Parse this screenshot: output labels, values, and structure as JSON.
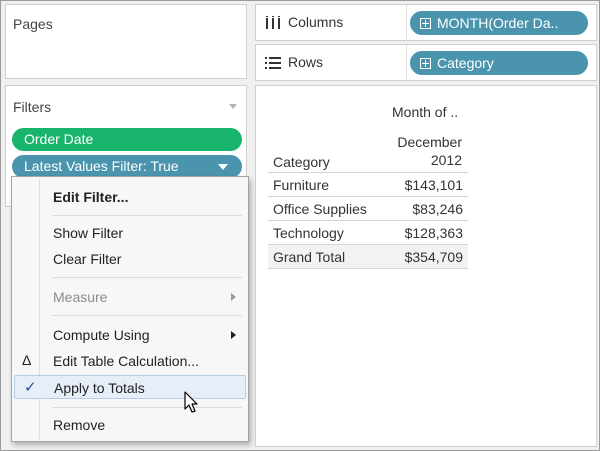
{
  "pages_panel": {
    "title": "Pages"
  },
  "filters_panel": {
    "title": "Filters",
    "pills": [
      {
        "label": "Order Date",
        "color": "#19b46b"
      },
      {
        "label": "Latest Values Filter: True",
        "color": "#4a95ad"
      }
    ]
  },
  "shelves": {
    "columns": {
      "label": "Columns",
      "pill": "MONTH(Order Da.."
    },
    "rows": {
      "label": "Rows",
      "pill": "Category"
    }
  },
  "viz": {
    "column_header": "Month of ..",
    "column_value_line1": "December",
    "column_value_line2": "2012",
    "row_header": "Category",
    "rows": [
      {
        "category": "Furniture",
        "value": "$143,101"
      },
      {
        "category": "Office Supplies",
        "value": "$83,246"
      },
      {
        "category": "Technology",
        "value": "$128,363"
      }
    ],
    "grand_total": {
      "category": "Grand Total",
      "value": "$354,709"
    }
  },
  "context_menu": {
    "edit_filter": "Edit Filter...",
    "show_filter": "Show Filter",
    "clear_filter": "Clear Filter",
    "measure": "Measure",
    "compute_using": "Compute Using",
    "edit_table_calculation": "Edit Table Calculation...",
    "apply_to_totals": "Apply to Totals",
    "remove": "Remove",
    "delta_glyph": "Δ",
    "check_glyph": "✓"
  },
  "colors": {
    "dimension_pill": "#4a95ad",
    "filter_pill": "#19b46b",
    "menu_hover": "#e6eef8",
    "checkmark": "#2b4aa0"
  }
}
